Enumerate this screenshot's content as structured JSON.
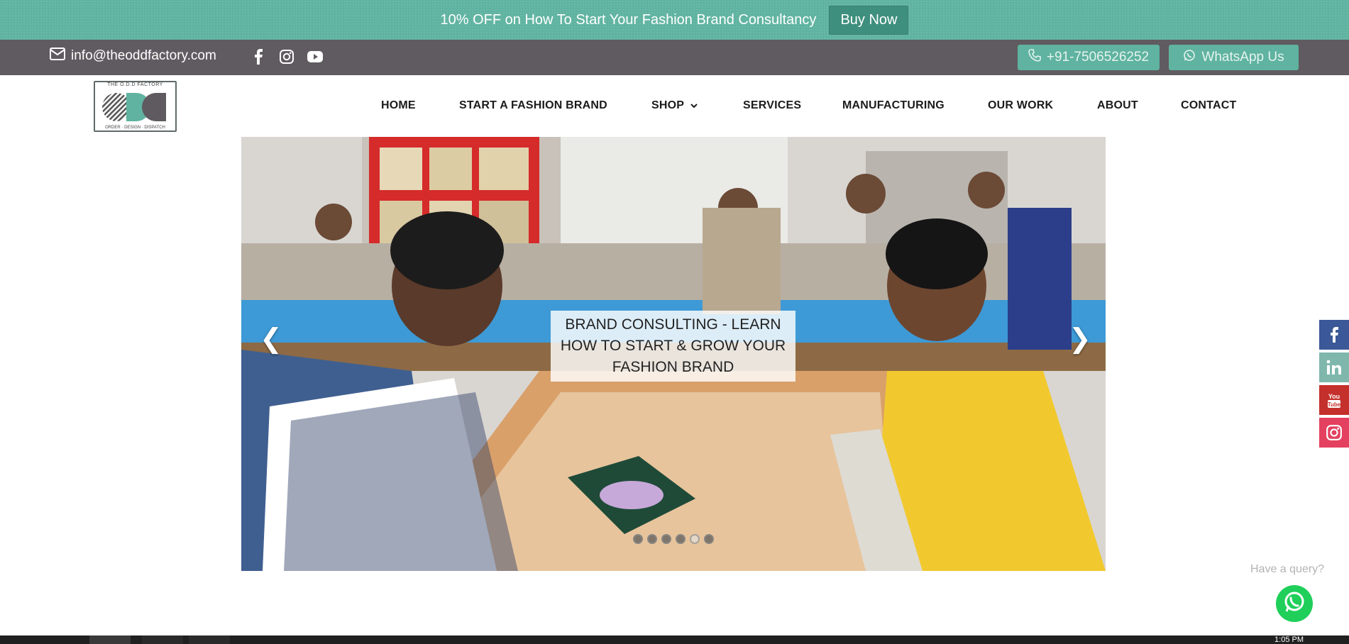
{
  "promo": {
    "text": "10% OFF on How To Start Your Fashion Brand Consultancy",
    "button": "Buy Now"
  },
  "contact": {
    "email": "info@theoddfactory.com",
    "phone": "+91-7506526252",
    "whatsapp": "WhatsApp Us",
    "social": [
      "facebook-icon",
      "instagram-icon",
      "youtube-icon"
    ]
  },
  "logo": {
    "top_text": "THE O.D.D FACTORY",
    "bottom_text": "ORDER · DESIGN · DISPATCH"
  },
  "nav": {
    "items": [
      {
        "label": "HOME"
      },
      {
        "label": "START A FASHION BRAND"
      },
      {
        "label": "SHOP"
      },
      {
        "label": "SERVICES"
      },
      {
        "label": "MANUFACTURING"
      },
      {
        "label": "OUR WORK"
      },
      {
        "label": "ABOUT"
      },
      {
        "label": "CONTACT"
      }
    ]
  },
  "slider": {
    "caption": "BRAND CONSULTING - LEARN HOW TO START & GROW YOUR FASHION BRAND",
    "prev": "❮",
    "next": "❯",
    "dot_count": 6,
    "active_dot": 5
  },
  "side_social": [
    "facebook-icon",
    "linkedin-icon",
    "youtube-icon",
    "instagram-icon"
  ],
  "query": {
    "text": "Have a query?"
  },
  "taskbar": {
    "clock": "1:05 PM"
  },
  "colors": {
    "accent": "#5fb3a0",
    "contact_bar": "#605b60",
    "facebook": "#3b5998",
    "linkedin": "#7fb7ad",
    "youtube": "#c4302b",
    "instagram": "#e4405f",
    "whatsapp": "#1fcf5a"
  }
}
